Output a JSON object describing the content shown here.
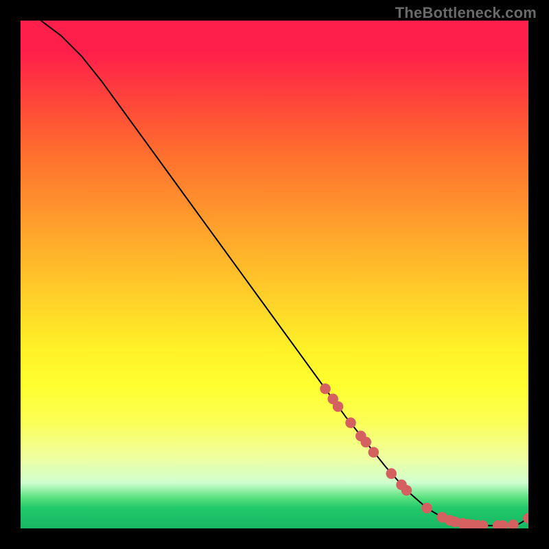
{
  "watermark": "TheBottleneck.com",
  "chart_data": {
    "type": "line",
    "title": "",
    "xlabel": "",
    "ylabel": "",
    "xlim": [
      0,
      100
    ],
    "ylim": [
      0,
      100
    ],
    "series": [
      {
        "name": "curve",
        "x": [
          4,
          8,
          12,
          16,
          20,
          24,
          28,
          32,
          36,
          40,
          44,
          48,
          52,
          56,
          60,
          64,
          68,
          72,
          76,
          80,
          83,
          86,
          88,
          90,
          92,
          94,
          96,
          98,
          100
        ],
        "y": [
          100,
          97,
          93,
          88,
          82.5,
          77,
          71.5,
          66,
          60.5,
          55,
          49.5,
          44,
          38.5,
          33,
          27.5,
          22,
          17,
          12,
          7.5,
          4,
          2.2,
          1.2,
          0.8,
          0.6,
          0.55,
          0.55,
          0.6,
          0.8,
          2.0
        ]
      }
    ],
    "highlight_points": {
      "name": "highlighted-points",
      "color": "#d46060",
      "points": [
        {
          "x": 60.0,
          "y": 27.5
        },
        {
          "x": 61.5,
          "y": 25.5
        },
        {
          "x": 62.5,
          "y": 24.0
        },
        {
          "x": 65.0,
          "y": 20.8
        },
        {
          "x": 67.0,
          "y": 18.2
        },
        {
          "x": 68.0,
          "y": 17.0
        },
        {
          "x": 69.5,
          "y": 15.0
        },
        {
          "x": 73.0,
          "y": 10.8
        },
        {
          "x": 75.0,
          "y": 8.6
        },
        {
          "x": 76.0,
          "y": 7.5
        },
        {
          "x": 80.0,
          "y": 4.0
        },
        {
          "x": 83.0,
          "y": 2.2
        },
        {
          "x": 84.5,
          "y": 1.6
        },
        {
          "x": 85.5,
          "y": 1.3
        },
        {
          "x": 87.0,
          "y": 1.0
        },
        {
          "x": 88.0,
          "y": 0.8
        },
        {
          "x": 89.0,
          "y": 0.7
        },
        {
          "x": 90.0,
          "y": 0.6
        },
        {
          "x": 91.0,
          "y": 0.55
        },
        {
          "x": 94.0,
          "y": 0.55
        },
        {
          "x": 95.0,
          "y": 0.55
        },
        {
          "x": 97.0,
          "y": 0.7
        },
        {
          "x": 100.0,
          "y": 2.0
        }
      ]
    }
  }
}
